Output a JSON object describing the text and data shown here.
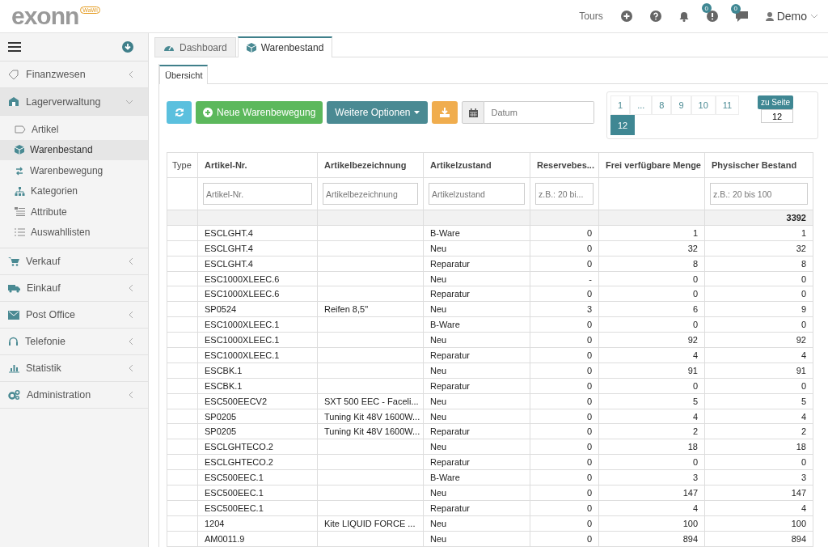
{
  "header": {
    "logo": "exonn",
    "logo_badge": "WaWi",
    "tours": "Tours",
    "alerts_count": "0",
    "messages_count": "0",
    "user": "Demo"
  },
  "sidebar": {
    "items": [
      {
        "label": "Finanzwesen",
        "selected": false,
        "expanded": false
      },
      {
        "label": "Lagerverwaltung",
        "selected": true,
        "expanded": true,
        "children": [
          {
            "label": "Artikel",
            "selected": false
          },
          {
            "label": "Warenbestand",
            "selected": true
          },
          {
            "label": "Warenbewegung",
            "selected": false
          },
          {
            "label": "Kategorien",
            "selected": false
          },
          {
            "label": "Attribute",
            "selected": false
          },
          {
            "label": "Auswahllisten",
            "selected": false
          }
        ]
      },
      {
        "label": "Verkauf",
        "selected": false,
        "expanded": false
      },
      {
        "label": "Einkauf",
        "selected": false,
        "expanded": false
      },
      {
        "label": "Post Office",
        "selected": false,
        "expanded": false
      },
      {
        "label": "Telefonie",
        "selected": false,
        "expanded": false
      },
      {
        "label": "Statistik",
        "selected": false,
        "expanded": false
      },
      {
        "label": "Administration",
        "selected": false,
        "expanded": false
      }
    ]
  },
  "tabs": [
    {
      "label": "Dashboard",
      "selected": false
    },
    {
      "label": "Warenbestand",
      "selected": true
    }
  ],
  "subtabs": [
    {
      "label": "Übersicht",
      "selected": true
    }
  ],
  "toolbar": {
    "new_button": "Neue Warenbewegung",
    "options_button": "Weitere Optionen",
    "date_placeholder": "Datum"
  },
  "pagination": {
    "pages": [
      {
        "label": "1",
        "selected": false
      },
      {
        "label": "...",
        "selected": false
      },
      {
        "label": "8",
        "selected": false
      },
      {
        "label": "9",
        "selected": false
      },
      {
        "label": "10",
        "selected": false
      },
      {
        "label": "11",
        "selected": false
      },
      {
        "label": "12",
        "selected": true
      }
    ],
    "goto_label": "zu Seite",
    "goto_value": "12"
  },
  "table": {
    "columns": [
      {
        "label": "Type"
      },
      {
        "label": "Artikel-Nr.",
        "filter": {
          "placeholder": "Artikel-Nr."
        }
      },
      {
        "label": "Artikelbezeichnung",
        "filter": {
          "placeholder": "Artikelbezeichnung"
        }
      },
      {
        "label": "Artikelzustand",
        "filter": {
          "placeholder": "Artikelzustand"
        }
      },
      {
        "label": "Reservebes...",
        "filter": {
          "placeholder": "z.B.: 20 bi..."
        }
      },
      {
        "label": "Frei verfügbare Menge"
      },
      {
        "label": "Physischer Bestand",
        "filter": {
          "placeholder": "z.B.: 20 bis 100"
        },
        "total": "3392"
      }
    ],
    "rows": [
      [
        "",
        "ESCLGHT.4",
        "",
        "B-Ware",
        "0",
        "1",
        "1"
      ],
      [
        "",
        "ESCLGHT.4",
        "",
        "Neu",
        "0",
        "32",
        "32"
      ],
      [
        "",
        "ESCLGHT.4",
        "",
        "Reparatur",
        "0",
        "8",
        "8"
      ],
      [
        "",
        "ESC1000XLEEC.6",
        "",
        "Neu",
        "-",
        "0",
        "0"
      ],
      [
        "",
        "ESC1000XLEEC.6",
        "",
        "Reparatur",
        "0",
        "0",
        "0"
      ],
      [
        "",
        "SP0524",
        "Reifen 8,5\"",
        "Neu",
        "3",
        "6",
        "9"
      ],
      [
        "",
        "ESC1000XLEEC.1",
        "",
        "B-Ware",
        "0",
        "0",
        "0"
      ],
      [
        "",
        "ESC1000XLEEC.1",
        "",
        "Neu",
        "0",
        "92",
        "92"
      ],
      [
        "",
        "ESC1000XLEEC.1",
        "",
        "Reparatur",
        "0",
        "4",
        "4"
      ],
      [
        "",
        "ESCBK.1",
        "",
        "Neu",
        "0",
        "91",
        "91"
      ],
      [
        "",
        "ESCBK.1",
        "",
        "Reparatur",
        "0",
        "0",
        "0"
      ],
      [
        "",
        "ESC500EECV2",
        "SXT 500 EEC - Faceli...",
        "Neu",
        "0",
        "5",
        "5"
      ],
      [
        "",
        "SP0205",
        "Tuning Kit 48V 1600W...",
        "Neu",
        "0",
        "4",
        "4"
      ],
      [
        "",
        "SP0205",
        "Tuning Kit 48V 1600W...",
        "Reparatur",
        "0",
        "2",
        "2"
      ],
      [
        "",
        "ESCLGHTECO.2",
        "",
        "Neu",
        "0",
        "18",
        "18"
      ],
      [
        "",
        "ESCLGHTECO.2",
        "",
        "Reparatur",
        "0",
        "0",
        "0"
      ],
      [
        "",
        "ESC500EEC.1",
        "",
        "B-Ware",
        "0",
        "3",
        "3"
      ],
      [
        "",
        "ESC500EEC.1",
        "",
        "Neu",
        "0",
        "147",
        "147"
      ],
      [
        "",
        "ESC500EEC.1",
        "",
        "Reparatur",
        "0",
        "4",
        "4"
      ],
      [
        "",
        "1204",
        "Kite LIQUID FORCE ...",
        "Neu",
        "0",
        "100",
        "100"
      ],
      [
        "",
        "AM0011.9",
        "",
        "Neu",
        "0",
        "894",
        "894"
      ]
    ]
  }
}
